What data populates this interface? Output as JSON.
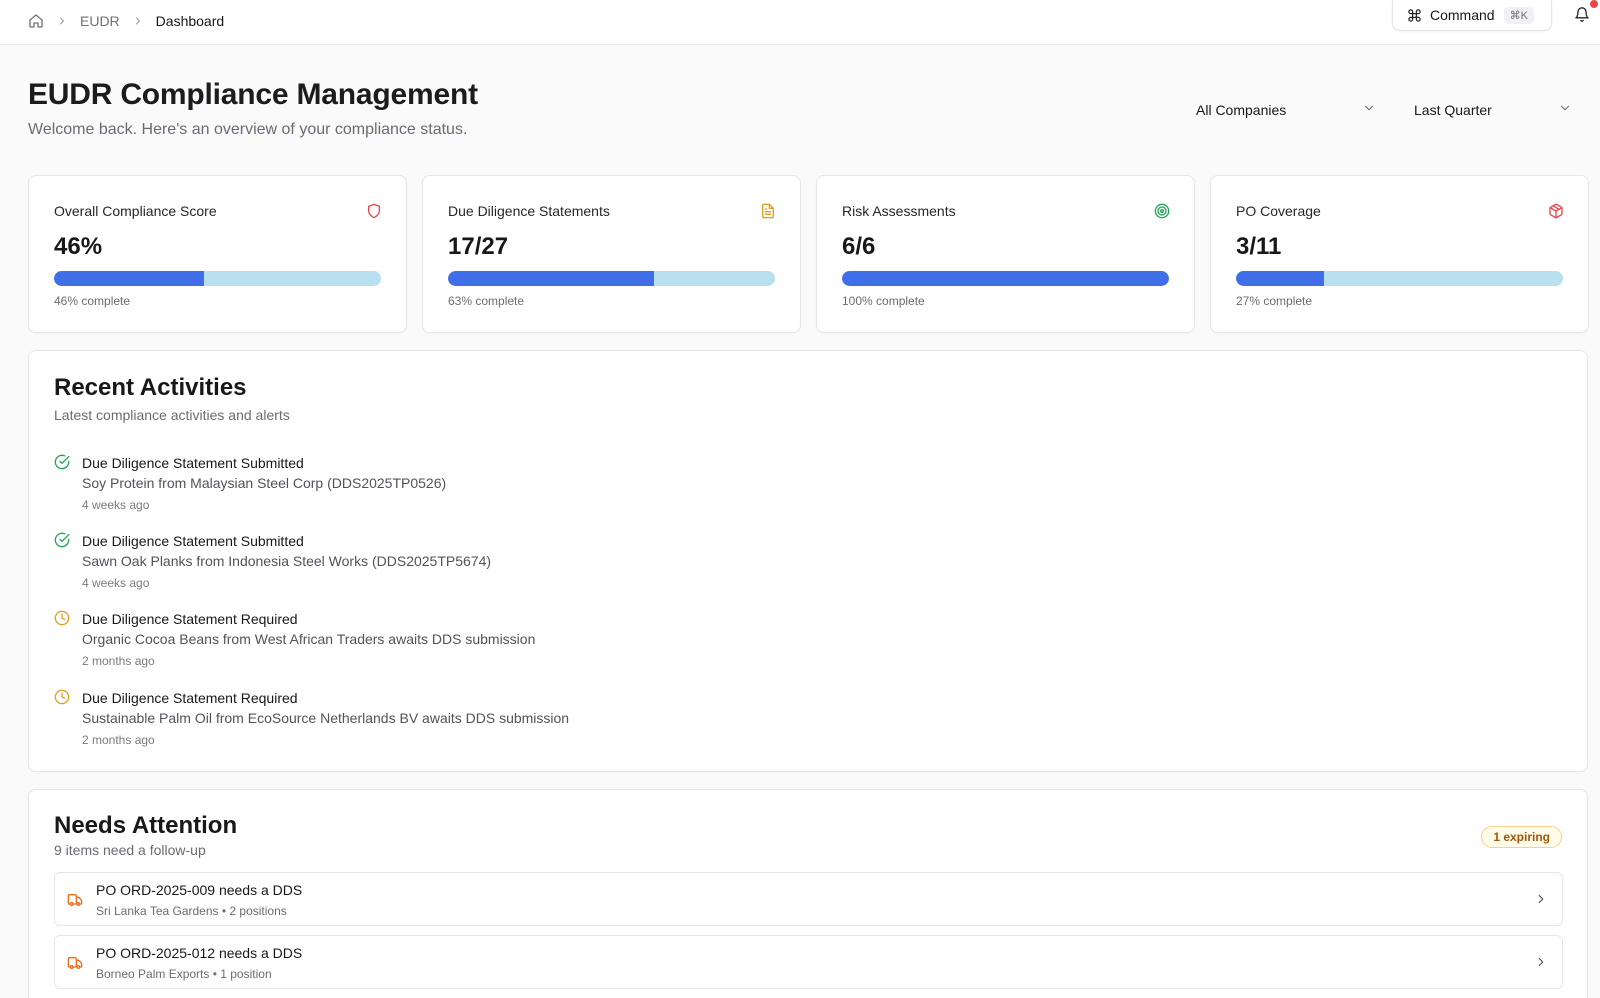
{
  "breadcrumb": {
    "items": [
      "EUDR",
      "Dashboard"
    ]
  },
  "command": {
    "label": "Command",
    "shortcut": "⌘K"
  },
  "header": {
    "title": "EUDR Compliance Management",
    "subtitle": "Welcome back. Here's an overview of your compliance status."
  },
  "filters": {
    "company": "All Companies",
    "period": "Last Quarter"
  },
  "stats": [
    {
      "label": "Overall Compliance Score",
      "value": "46%",
      "progress": 0.46,
      "caption": "46% complete",
      "icon": "shield-icon",
      "color": "#e5484d"
    },
    {
      "label": "Due Diligence Statements",
      "value": "17/27",
      "progress": 0.63,
      "caption": "63% complete",
      "icon": "document-icon",
      "color": "#e0a020"
    },
    {
      "label": "Risk Assessments",
      "value": "6/6",
      "progress": 1.0,
      "caption": "100% complete",
      "icon": "target-icon",
      "color": "#22a35a"
    },
    {
      "label": "PO Coverage",
      "value": "3/11",
      "progress": 0.27,
      "caption": "27% complete",
      "icon": "package-icon",
      "color": "#e5484d"
    }
  ],
  "recent": {
    "title": "Recent Activities",
    "subtitle": "Latest compliance activities and alerts",
    "items": [
      {
        "status": "check-circle-icon",
        "title": "Due Diligence Statement Submitted",
        "description": "Soy Protein from Malaysian Steel Corp (DDS2025TP0526)",
        "time": "4 weeks ago"
      },
      {
        "status": "check-circle-icon",
        "title": "Due Diligence Statement Submitted",
        "description": "Sawn Oak Planks from Indonesia Steel Works (DDS2025TP5674)",
        "time": "4 weeks ago"
      },
      {
        "status": "clock-icon",
        "title": "Due Diligence Statement Required",
        "description": "Organic Cocoa Beans from West African Traders awaits DDS submission",
        "time": "2 months ago"
      },
      {
        "status": "clock-icon",
        "title": "Due Diligence Statement Required",
        "description": "Sustainable Palm Oil from EcoSource Netherlands BV awaits DDS submission",
        "time": "2 months ago"
      }
    ]
  },
  "attention": {
    "title": "Needs Attention",
    "subtitle": "9 items need a follow-up",
    "badge": "1 expiring",
    "items": [
      {
        "title": "PO ORD-2025-009 needs a DDS",
        "subtitle": "Sri Lanka Tea Gardens • 2 positions",
        "icon": "truck-icon"
      },
      {
        "title": "PO ORD-2025-012 needs a DDS",
        "subtitle": "Borneo Palm Exports • 1 position",
        "icon": "truck-icon"
      }
    ]
  },
  "colors": {
    "accent": "#3f6ee8",
    "track": "#b8e0ee",
    "success": "#22a35a",
    "warning": "#e0a020",
    "danger": "#e5484d",
    "truck": "#f26b1d"
  }
}
